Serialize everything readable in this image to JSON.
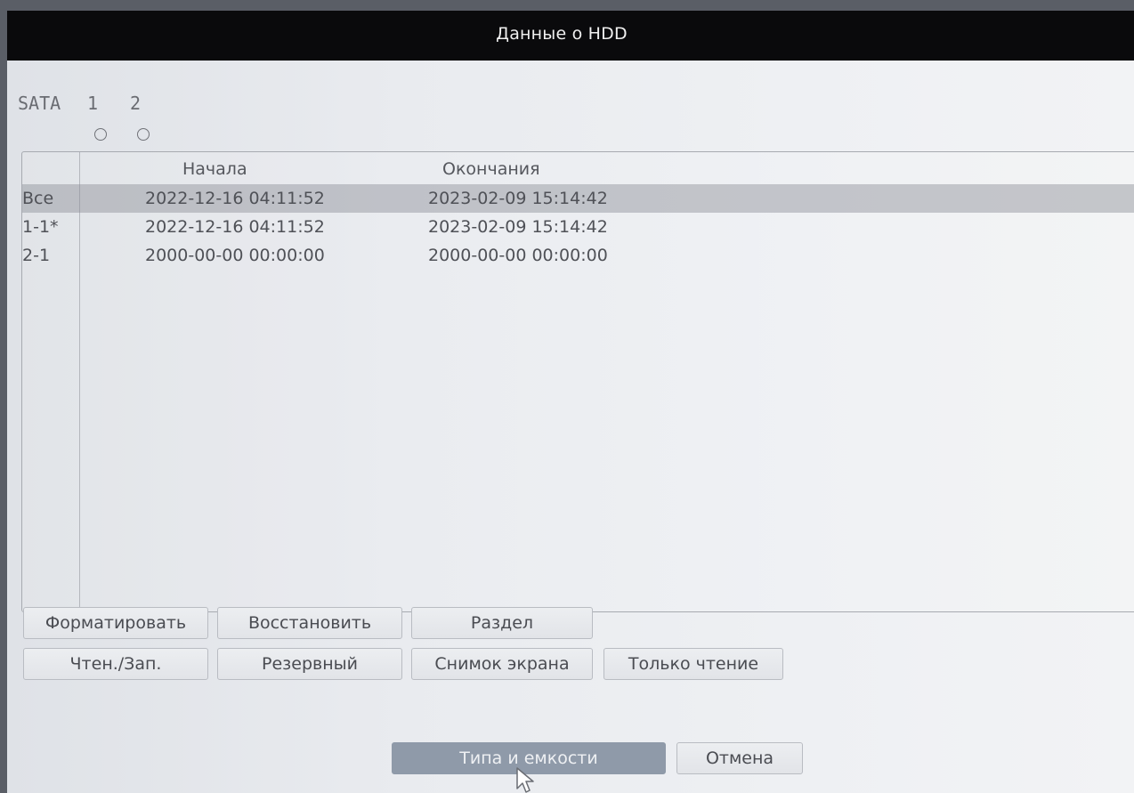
{
  "window": {
    "title": "Данные о HDD"
  },
  "sata": {
    "label": "SATA",
    "disks": [
      {
        "number": "1"
      },
      {
        "number": "2"
      }
    ]
  },
  "table": {
    "columns": {
      "start": "Начала",
      "end": "Окончания"
    },
    "rows": [
      {
        "id": "Все",
        "start": "2022-12-16 04:11:52",
        "end": "2023-02-09 15:14:42",
        "selected": true
      },
      {
        "id": "1-1*",
        "start": "2022-12-16 04:11:52",
        "end": "2023-02-09 15:14:42",
        "selected": false
      },
      {
        "id": "2-1",
        "start": "2000-00-00 00:00:00",
        "end": "2000-00-00 00:00:00",
        "selected": false
      }
    ]
  },
  "buttons": {
    "format": "Форматировать",
    "restore": "Восстановить",
    "partition": "Раздел",
    "read_write": "Чтен./Зап.",
    "backup": "Резервный",
    "snapshot": "Снимок экрана",
    "read_only": "Только чтение",
    "type_capacity": "Типа и емкости",
    "cancel": "Отмена"
  },
  "colors": {
    "titlebar": "#0a0a0c",
    "selected_row": "#8c8f96",
    "primary_button": "#8f9aa9"
  }
}
